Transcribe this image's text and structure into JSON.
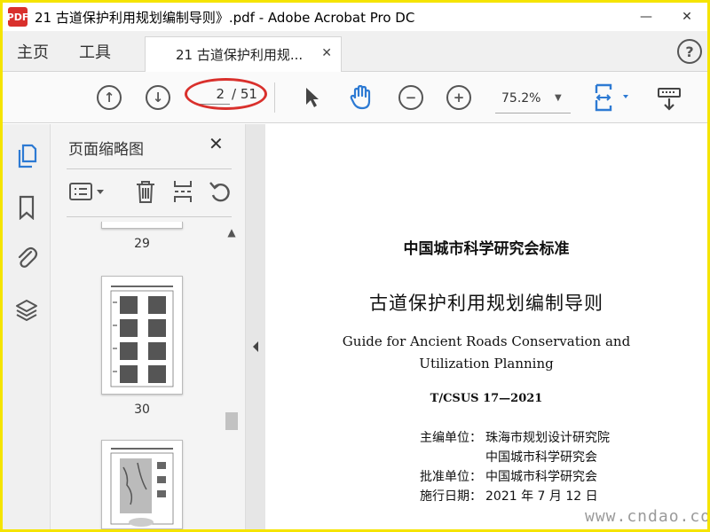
{
  "window": {
    "title": "21 古道保护利用规划编制导则》.pdf - Adobe Acrobat Pro DC",
    "app_icon_label": "PDF",
    "minimize": "—",
    "close": "✕"
  },
  "tabs": {
    "home": "主页",
    "tools": "工具",
    "document": "21 古道保护利用规...",
    "document_close": "✕",
    "help": "?"
  },
  "toolbar": {
    "page_current": "2",
    "page_total": "/ 51",
    "zoom": "75.2%",
    "zoom_caret": "▼",
    "prev_page_glyph": "↑",
    "next_page_glyph": "↓",
    "zoom_out_glyph": "−",
    "zoom_in_glyph": "+"
  },
  "thumbnails": {
    "title": "页面缩略图",
    "close": "✕",
    "scroll_up": "▲",
    "pages": [
      "29",
      "30"
    ]
  },
  "document": {
    "org_title": "中国城市科学研究会标准",
    "cn_title": "古道保护利用规划编制导则",
    "en_title_1": "Guide for Ancient Roads Conservation and",
    "en_title_2": "Utilization Planning",
    "standard_no": "T/CSUS 17—2021",
    "chief_unit_label": "主编单位：",
    "chief_unit_1": "珠海市规划设计研究院",
    "chief_unit_2": "中国城市科学研究会",
    "approval_label": "批准单位：",
    "approval_unit": "中国城市科学研究会",
    "effective_label": "施行日期：",
    "effective_date": "2021 年 7 月 12 日"
  },
  "watermark": "www.cndao.com",
  "colors": {
    "highlight_red": "#d9302c",
    "frame_yellow": "#f5e400",
    "accent_blue": "#2d7ad3"
  }
}
